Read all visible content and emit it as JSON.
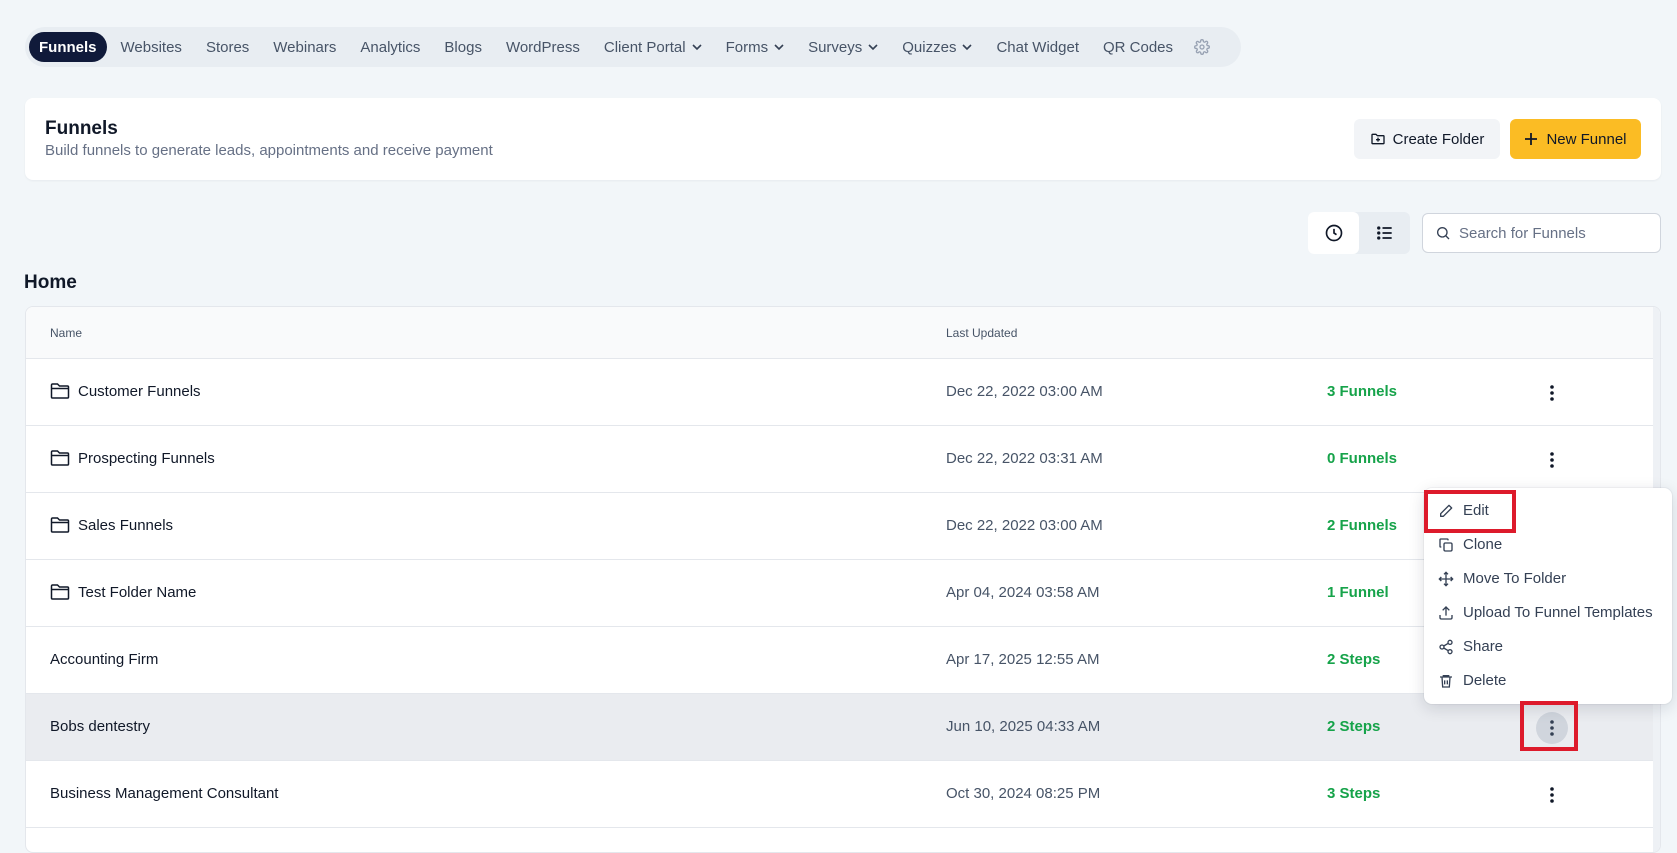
{
  "nav": {
    "items": [
      {
        "label": "Funnels",
        "dropdown": false
      },
      {
        "label": "Websites",
        "dropdown": false
      },
      {
        "label": "Stores",
        "dropdown": false
      },
      {
        "label": "Webinars",
        "dropdown": false
      },
      {
        "label": "Analytics",
        "dropdown": false
      },
      {
        "label": "Blogs",
        "dropdown": false
      },
      {
        "label": "WordPress",
        "dropdown": false
      },
      {
        "label": "Client Portal",
        "dropdown": true
      },
      {
        "label": "Forms",
        "dropdown": true
      },
      {
        "label": "Surveys",
        "dropdown": true
      },
      {
        "label": "Quizzes",
        "dropdown": true
      },
      {
        "label": "Chat Widget",
        "dropdown": false
      },
      {
        "label": "QR Codes",
        "dropdown": false
      }
    ],
    "active": "Funnels"
  },
  "header": {
    "title": "Funnels",
    "subtitle": "Build funnels to generate leads, appointments and receive payment",
    "create_folder_label": "Create Folder",
    "new_funnel_label": "New Funnel"
  },
  "search": {
    "placeholder": "Search for Funnels",
    "value": ""
  },
  "section_title": "Home",
  "table": {
    "headers": {
      "name": "Name",
      "last_updated": "Last Updated"
    },
    "rows": [
      {
        "name": "Customer Funnels",
        "is_folder": true,
        "date": "Dec 22, 2022 03:00 AM",
        "count": "3 Funnels"
      },
      {
        "name": "Prospecting Funnels",
        "is_folder": true,
        "date": "Dec 22, 2022 03:31 AM",
        "count": "0 Funnels"
      },
      {
        "name": "Sales Funnels",
        "is_folder": true,
        "date": "Dec 22, 2022 03:00 AM",
        "count": "2 Funnels"
      },
      {
        "name": "Test Folder Name",
        "is_folder": true,
        "date": "Apr 04, 2024 03:58 AM",
        "count": "1 Funnel"
      },
      {
        "name": "Accounting Firm",
        "is_folder": false,
        "date": "Apr 17, 2025 12:55 AM",
        "count": "2 Steps"
      },
      {
        "name": "Bobs dentestry",
        "is_folder": false,
        "date": "Jun 10, 2025 04:33 AM",
        "count": "2 Steps"
      },
      {
        "name": "Business Management Consultant",
        "is_folder": false,
        "date": "Oct 30, 2024 08:25 PM",
        "count": "3 Steps"
      }
    ]
  },
  "context_menu": {
    "items": [
      {
        "label": "Edit",
        "icon": "pencil-icon"
      },
      {
        "label": "Clone",
        "icon": "copy-icon"
      },
      {
        "label": "Move To Folder",
        "icon": "move-icon"
      },
      {
        "label": "Upload To Funnel Templates",
        "icon": "upload-icon"
      },
      {
        "label": "Share",
        "icon": "share-icon"
      },
      {
        "label": "Delete",
        "icon": "trash-icon"
      }
    ]
  },
  "colors": {
    "active_nav": "#101a3a",
    "primary_button": "#fbbc24",
    "count_green": "#16a34a",
    "highlight_red": "#dd1a2b"
  }
}
